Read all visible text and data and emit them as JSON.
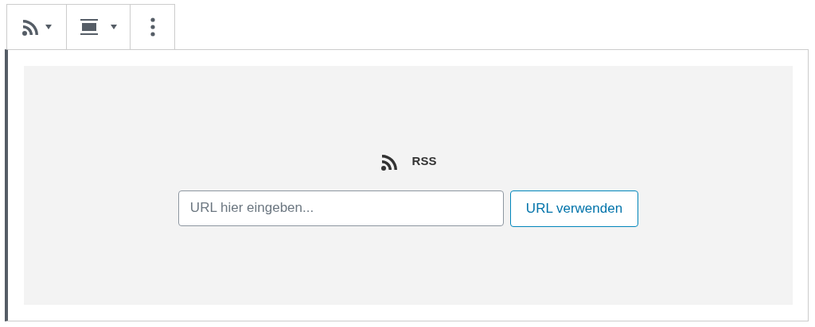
{
  "block": {
    "title": "RSS",
    "url_field": {
      "placeholder": "URL hier eingeben..."
    },
    "submit_button": "URL verwenden"
  }
}
